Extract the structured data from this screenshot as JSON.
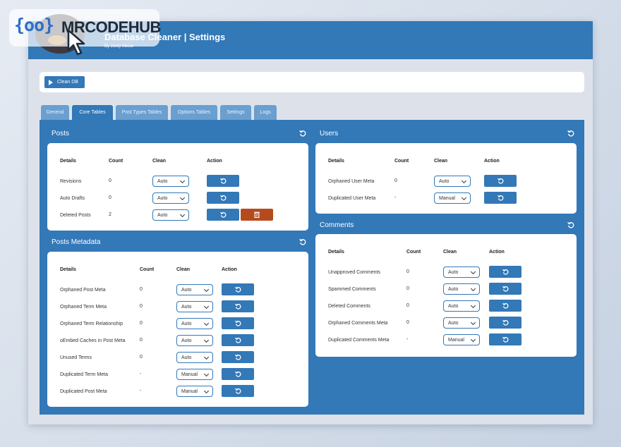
{
  "watermark": {
    "text": "MRCODEHUB",
    "icon": "{oo}"
  },
  "header": {
    "title": "Database Cleaner | Settings",
    "subtitle": "By Jordy Meow"
  },
  "clean_db_label": "Clean DB",
  "tabs": [
    "General",
    "Core Tables",
    "Post Types Tables",
    "Options Tables",
    "Settings",
    "Logs"
  ],
  "active_tab": "Core Tables",
  "columns": {
    "details": "Details",
    "count": "Count",
    "clean": "Clean",
    "action": "Action"
  },
  "colors": {
    "primary": "#3378b7",
    "danger": "#b54b1d",
    "tab_inactive": "#6a9fd0"
  },
  "sections": {
    "posts": {
      "title": "Posts",
      "rows": [
        {
          "details": "Revisions",
          "count": "0",
          "clean": "Auto"
        },
        {
          "details": "Auto Drafts",
          "count": "0",
          "clean": "Auto"
        },
        {
          "details": "Deleted Posts",
          "count": "2",
          "clean": "Auto"
        }
      ]
    },
    "posts_metadata": {
      "title": "Posts Metadata",
      "rows": [
        {
          "details": "Orphaned Post Meta",
          "count": "0",
          "clean": "Auto"
        },
        {
          "details": "Orphaned Term Meta",
          "count": "0",
          "clean": "Auto"
        },
        {
          "details": "Orphaned Term Relationship",
          "count": "0",
          "clean": "Auto"
        },
        {
          "details": "oEmbed Caches in Post Meta",
          "count": "0",
          "clean": "Auto"
        },
        {
          "details": "Unused Terms",
          "count": "0",
          "clean": "Auto"
        },
        {
          "details": "Duplicated Term Meta",
          "count": "-",
          "clean": "Manual"
        },
        {
          "details": "Duplicated Post Meta",
          "count": "-",
          "clean": "Manual"
        }
      ]
    },
    "users": {
      "title": "Users",
      "rows": [
        {
          "details": "Orphaned User Meta",
          "count": "0",
          "clean": "Auto"
        },
        {
          "details": "Duplicated User Meta",
          "count": "-",
          "clean": "Manual"
        }
      ]
    },
    "comments": {
      "title": "Comments",
      "rows": [
        {
          "details": "Unapproved Comments",
          "count": "0",
          "clean": "Auto"
        },
        {
          "details": "Spammed Comments",
          "count": "0",
          "clean": "Auto"
        },
        {
          "details": "Deleted Comments",
          "count": "0",
          "clean": "Auto"
        },
        {
          "details": "Orphaned Comments Meta",
          "count": "0",
          "clean": "Auto"
        },
        {
          "details": "Duplicated Comments Meta",
          "count": "-",
          "clean": "Manual"
        }
      ]
    }
  }
}
